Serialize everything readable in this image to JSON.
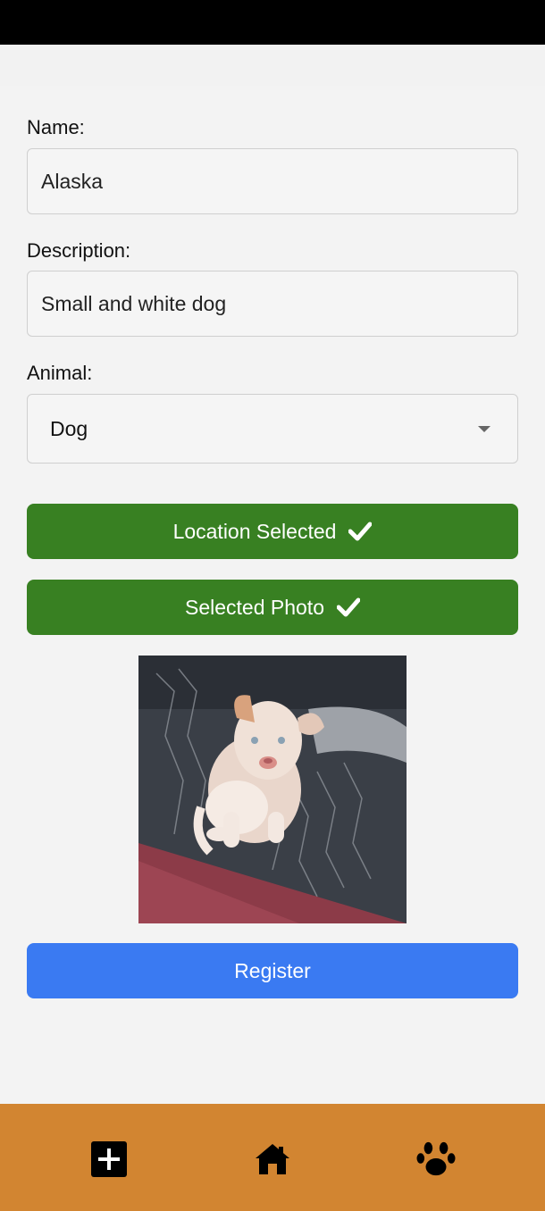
{
  "form": {
    "name_label": "Name:",
    "name_value": "Alaska",
    "description_label": "Description:",
    "description_value": "Small and white dog",
    "animal_label": "Animal:",
    "animal_value": "Dog"
  },
  "buttons": {
    "location_label": "Location Selected",
    "photo_label": "Selected Photo",
    "register_label": "Register"
  },
  "photo": {
    "subject": "white puppy on car seat"
  },
  "nav": {
    "items": [
      {
        "icon": "add-square-icon"
      },
      {
        "icon": "home-icon"
      },
      {
        "icon": "paw-icon"
      }
    ]
  },
  "colors": {
    "status_bar": "#000000",
    "background": "#f3f3f3",
    "success_button": "#388022",
    "primary_button": "#3a7af2",
    "nav_bar": "#d28531"
  }
}
